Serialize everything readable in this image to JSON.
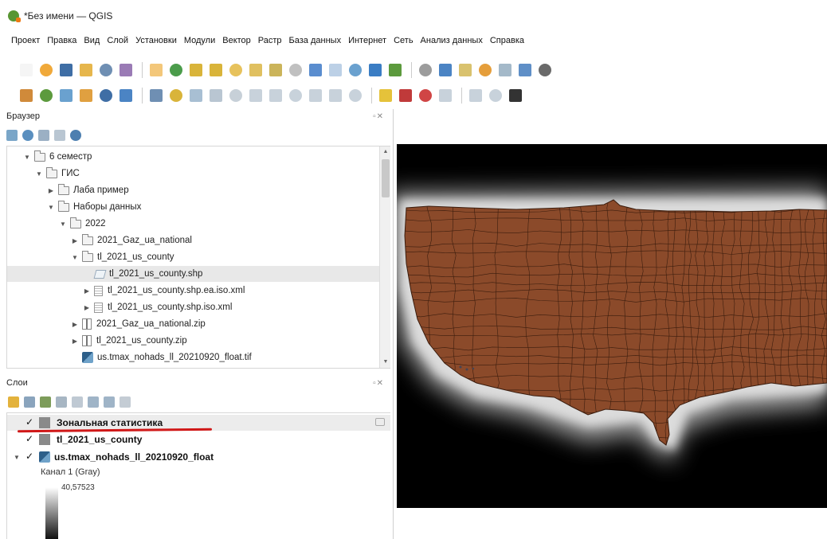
{
  "window": {
    "title": "*Без имени — QGIS"
  },
  "menu": [
    "Проект",
    "Правка",
    "Вид",
    "Слой",
    "Установки",
    "Модули",
    "Вектор",
    "Растр",
    "База данных",
    "Интернет",
    "Сеть",
    "Анализ данных",
    "Справка"
  ],
  "toolbar_icons": {
    "row1": [
      "new-project-icon",
      "open-project-icon",
      "save-project-icon",
      "save-as-icon",
      "print-layout-icon",
      "layout-manager-icon",
      "pan-icon",
      "pan-to-selection-icon",
      "zoom-in-icon",
      "zoom-out-icon",
      "zoom-full-icon",
      "zoom-to-selection-icon",
      "zoom-to-layer-icon",
      "zoom-native-icon",
      "zoom-last-icon",
      "zoom-next-icon",
      "new-map-view-icon",
      "temporal-icon",
      "refresh-icon",
      "identify-icon",
      "select-icon",
      "deselect-icon",
      "attribute-table-icon",
      "statistics-icon",
      "measure-icon",
      "sum-icon"
    ],
    "row2": [
      "data-source-manager-icon",
      "new-layer-icon",
      "new-shapefile-icon",
      "new-spatialite-icon",
      "add-raster-icon",
      "add-vector-icon",
      "digitize-icon",
      "edit-icon",
      "save-edits-icon",
      "add-feature-icon",
      "move-feature-icon",
      "delete-icon",
      "cut-icon",
      "copy-icon",
      "paste-icon",
      "undo-icon",
      "redo-icon",
      "label-icon",
      "label-pin-icon",
      "label-show-icon",
      "label-move-icon",
      "label-rotate-icon",
      "label-change-icon",
      "plugin-icon"
    ]
  },
  "browser": {
    "title": "Браузер",
    "controls": "▫✕",
    "items": [
      {
        "label": "6 семестр",
        "type": "folder",
        "level": 1,
        "arrow": "▼"
      },
      {
        "label": "ГИС",
        "type": "folder",
        "level": 2,
        "arrow": "▼"
      },
      {
        "label": "Лаба пример",
        "type": "folder",
        "level": 3,
        "arrow": "▶"
      },
      {
        "label": "Наборы данных",
        "type": "folder",
        "level": 3,
        "arrow": "▼"
      },
      {
        "label": "2022",
        "type": "folder",
        "level": 4,
        "arrow": "▼"
      },
      {
        "label": "2021_Gaz_ua_national",
        "type": "folder",
        "level": 5,
        "arrow": "▶"
      },
      {
        "label": "tl_2021_us_county",
        "type": "folder",
        "level": 5,
        "arrow": "▼"
      },
      {
        "label": "tl_2021_us_county.shp",
        "type": "shp",
        "level": 6,
        "arrow": ""
      },
      {
        "label": "tl_2021_us_county.shp.ea.iso.xml",
        "type": "xml",
        "level": 6,
        "arrow": "▶"
      },
      {
        "label": "tl_2021_us_county.shp.iso.xml",
        "type": "xml",
        "level": 6,
        "arrow": "▶"
      },
      {
        "label": "2021_Gaz_ua_national.zip",
        "type": "zip",
        "level": 5,
        "arrow": "▶"
      },
      {
        "label": "tl_2021_us_county.zip",
        "type": "zip",
        "level": 5,
        "arrow": "▶"
      },
      {
        "label": "us.tmax_nohads_ll_20210920_float.tif",
        "type": "tif",
        "level": 5,
        "arrow": ""
      }
    ]
  },
  "layers": {
    "title": "Слои",
    "controls": "▫✕",
    "items": [
      {
        "label": "Зональная статистика",
        "checked": true
      },
      {
        "label": "tl_2021_us_county",
        "checked": true
      },
      {
        "label": "us.tmax_nohads_ll_20210920_float",
        "checked": true,
        "expand": "▼"
      }
    ],
    "band_label": "Канал 1 (Gray)",
    "max_value": "40,57523"
  },
  "colors": {
    "county_fill": "#8b4a2a",
    "county_stroke": "#3a1c0d",
    "raster_glow": "#d0d0d0",
    "underline": "#d01818"
  }
}
